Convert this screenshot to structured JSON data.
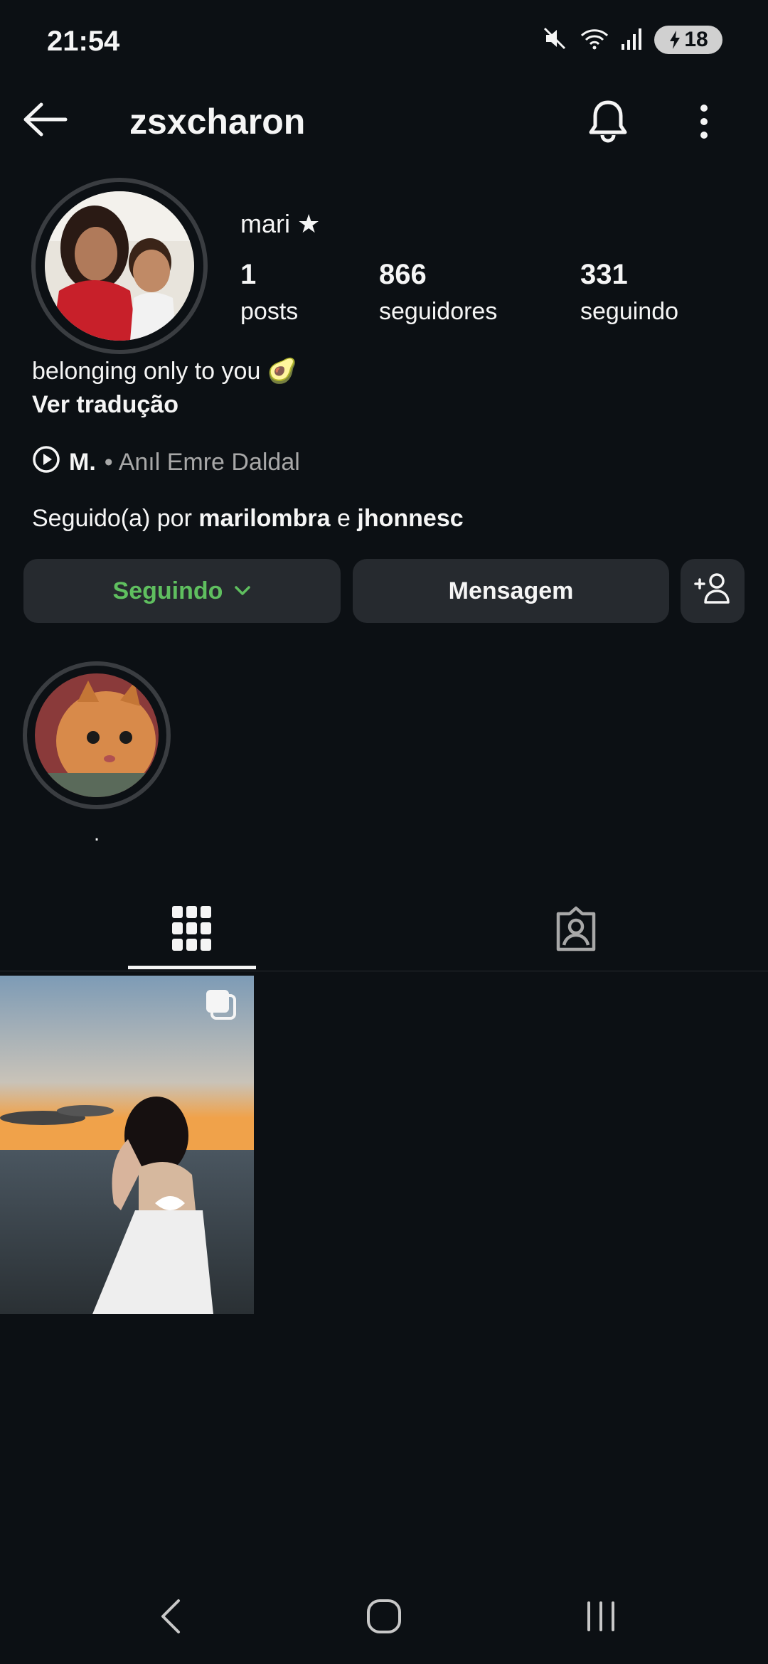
{
  "status_bar": {
    "time": "21:54",
    "battery": "18",
    "icons": [
      "mute-icon",
      "wifi-icon",
      "signal-icon",
      "battery-charging-icon"
    ]
  },
  "header": {
    "username": "zsxcharon",
    "icons": [
      "back-arrow-icon",
      "bell-icon",
      "more-vertical-icon"
    ]
  },
  "profile": {
    "display_name": "mari ★",
    "stats": [
      {
        "value": "1",
        "label": "posts"
      },
      {
        "value": "866",
        "label": "seguidores"
      },
      {
        "value": "331",
        "label": "seguindo"
      }
    ],
    "bio": "belonging only to you 🥑",
    "translate_label": "Ver tradução",
    "music": {
      "track": "M.",
      "separator": "•",
      "artist": "Anıl Emre Daldal"
    },
    "followed_by": {
      "prefix": "Seguido(a) por",
      "user1": "marilombra",
      "joiner": "e",
      "user2": "jhonnesc"
    }
  },
  "actions": {
    "following_label": "Seguindo",
    "message_label": "Mensagem"
  },
  "highlights": [
    {
      "label": "."
    }
  ],
  "tabs": [
    "grid-icon",
    "tagged-icon"
  ],
  "colors": {
    "background": "#0c1014",
    "button_bg": "#262a2f",
    "following_green": "#5fbf5f",
    "text": "#f5f5f5",
    "muted": "#a8a8a8"
  }
}
